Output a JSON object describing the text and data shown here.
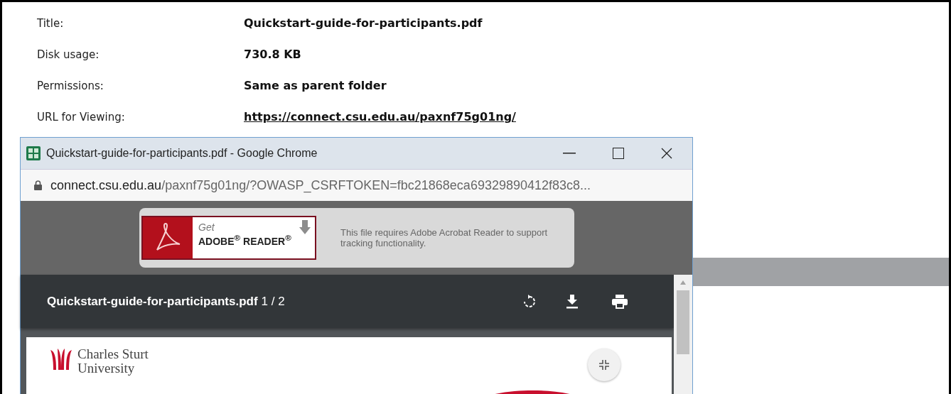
{
  "details": [
    {
      "label": "Title:",
      "value": "Quickstart-guide-for-participants.pdf",
      "link": false
    },
    {
      "label": "Disk usage:",
      "value": "730.8 KB",
      "link": false
    },
    {
      "label": "Permissions:",
      "value": "Same as parent folder",
      "link": false
    },
    {
      "label": "URL for Viewing:",
      "value": "https://connect.csu.edu.au/paxnf75g01ng/",
      "link": true
    }
  ],
  "popup": {
    "title": "Quickstart-guide-for-participants.pdf - Google Chrome",
    "address": {
      "host": "connect.csu.edu.au",
      "path": "/paxnf75g01ng/?OWASP_CSRFTOKEN=fbc21868eca69329890412f83c8..."
    },
    "banner": {
      "get": "Get",
      "product": "ADOBE$^{®}$ READER$^{®}$",
      "message": "This file requires Adobe Acrobat Reader to support tracking functionality."
    },
    "viewer": {
      "file": "Quickstart-guide-for-participants.pdf",
      "page": "1 / 2",
      "logo_line_1": "Charles Sturt",
      "logo_line_2": "University"
    }
  }
}
